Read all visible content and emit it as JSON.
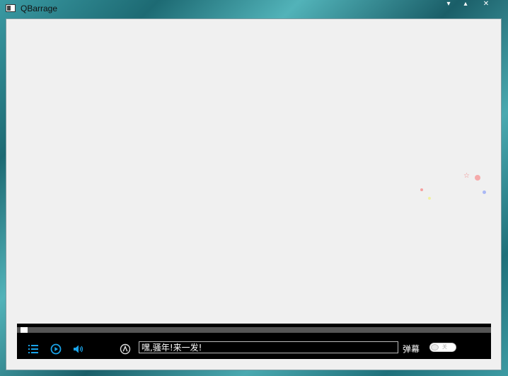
{
  "window": {
    "title": "QBarrage",
    "minimize_symbol": "▾",
    "maximize_symbol": "▴",
    "close_symbol": "✕"
  },
  "colors": {
    "accent": "#1aa3e8",
    "client_bg": "#f0f0f0",
    "control_bar_bg": "#000000",
    "progress_track": "#555555"
  },
  "playback": {
    "progress_fraction": 0.015
  },
  "controls": {
    "playlist_icon": "list-icon",
    "play_icon": "play-icon",
    "volume_icon": "volume-icon",
    "font_icon": "font-style-icon",
    "danmu_input_value": "嘿,骚年!来一发!",
    "danmu_label": "弹幕",
    "danmu_toggle_state": "关"
  }
}
